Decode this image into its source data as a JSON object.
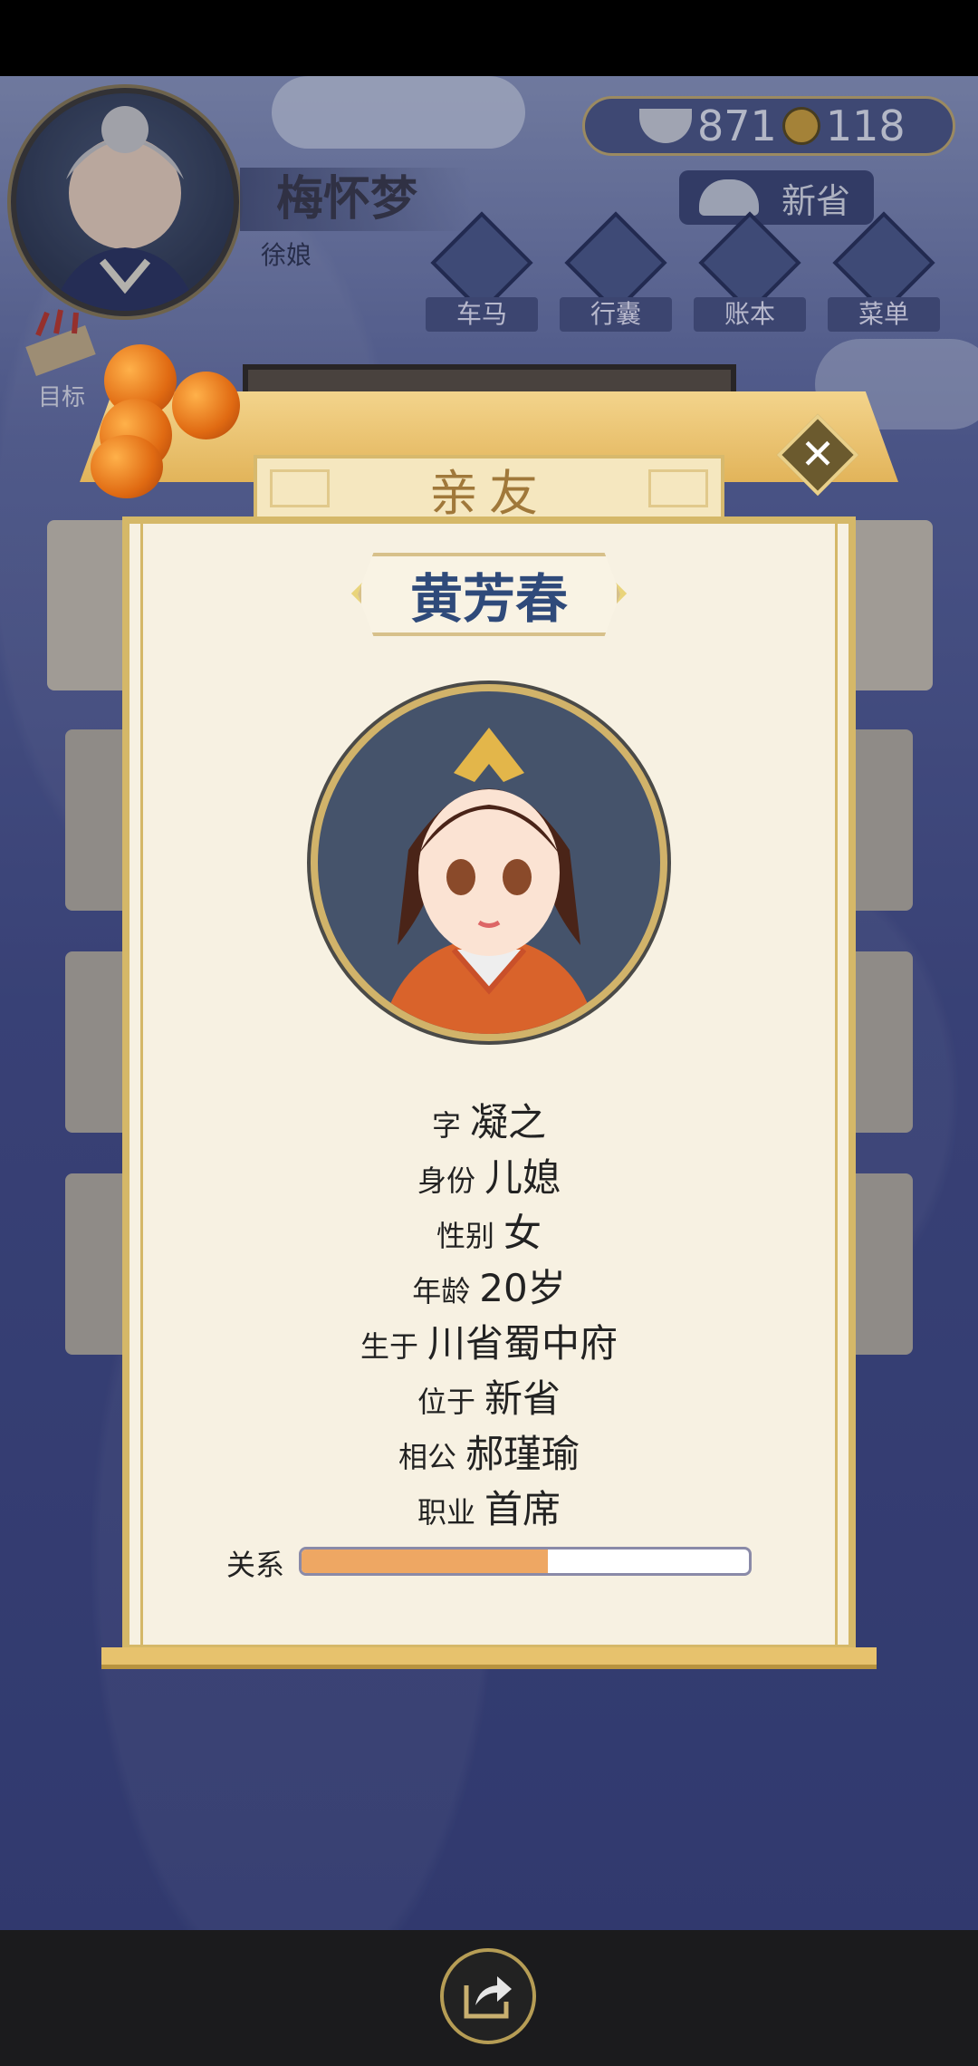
{
  "header": {
    "player_name": "梅怀梦",
    "player_title": "徐娘",
    "currency": {
      "silver": "871",
      "coins": "118"
    },
    "location": "新省",
    "menu": [
      {
        "label": "车马",
        "icon": "carriage-icon"
      },
      {
        "label": "行囊",
        "icon": "bag-icon"
      },
      {
        "label": "账本",
        "icon": "ledger-icon"
      },
      {
        "label": "菜单",
        "icon": "more-icon"
      }
    ],
    "target_label": "目标"
  },
  "modal": {
    "title": "亲友",
    "name": "黄芳春",
    "fields": [
      {
        "key": "字",
        "value": "凝之"
      },
      {
        "key": "身份",
        "value": "儿媳"
      },
      {
        "key": "性别",
        "value": "女"
      },
      {
        "key": "年龄",
        "value": "20岁"
      },
      {
        "key": "生于",
        "value": "川省蜀中府"
      },
      {
        "key": "位于",
        "value": "新省"
      },
      {
        "key": "相公",
        "value": "郝瑾瑜"
      },
      {
        "key": "职业",
        "value": "首席"
      }
    ],
    "relationship": {
      "label": "关系",
      "fraction": 0.55
    }
  },
  "colors": {
    "accent": "#d5b868",
    "relationship_fill": "#eea763",
    "name": "#2f4a7a"
  }
}
